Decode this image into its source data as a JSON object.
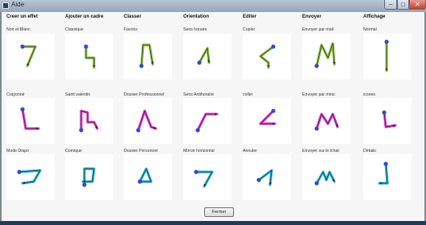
{
  "window": {
    "title": "Aide",
    "controls": {
      "minimize": "–",
      "maximize": "□",
      "close": "✕"
    }
  },
  "colors": {
    "green": "#8ac43f",
    "pink": "#e63bd2",
    "cyan": "#26b9dd",
    "dot": "#2f4cc8",
    "arrow": "#222222"
  },
  "columns": [
    {
      "header": "Creer un effet",
      "items": [
        {
          "label": "Noir et Blanc",
          "gesture": "seven-icon"
        },
        {
          "label": "Crayonné",
          "gesture": "sketch-icon"
        },
        {
          "label": "Mode Diapo",
          "gesture": "slideshow-icon"
        }
      ]
    },
    {
      "header": "Ajouter un cadre",
      "items": [
        {
          "label": "Classique",
          "gesture": "frame-classic-icon"
        },
        {
          "label": "Saint valentin",
          "gesture": "valentine-icon"
        },
        {
          "label": "Comique",
          "gesture": "comic-icon"
        }
      ]
    },
    {
      "header": "Classer",
      "items": [
        {
          "label": "Favoris",
          "gesture": "favorites-icon"
        },
        {
          "label": "Dossier Professionnel",
          "gesture": "pro-folder-icon"
        },
        {
          "label": "Dossier Personnel",
          "gesture": "personal-folder-icon"
        }
      ]
    },
    {
      "header": "Orientation",
      "items": [
        {
          "label": "Sens horaire",
          "gesture": "clockwise-icon"
        },
        {
          "label": "Sens Antihoraire",
          "gesture": "counterclockwise-icon"
        },
        {
          "label": "Mirroir horizontal",
          "gesture": "mirror-icon"
        }
      ]
    },
    {
      "header": "Editer",
      "items": [
        {
          "label": "Copier",
          "gesture": "copy-icon"
        },
        {
          "label": "coller",
          "gesture": "paste-icon"
        },
        {
          "label": "Annuler",
          "gesture": "undo-icon"
        }
      ]
    },
    {
      "header": "Envoyer",
      "items": [
        {
          "label": "Envoyer par mail",
          "gesture": "mail-icon"
        },
        {
          "label": "Envoyer par mms",
          "gesture": "mms-icon"
        },
        {
          "label": "Envoyer sur le tchat",
          "gesture": "chat-icon"
        }
      ]
    },
    {
      "header": "Affichage",
      "items": [
        {
          "label": "Normal",
          "gesture": "normal-icon"
        },
        {
          "label": "icones",
          "gesture": "icons-icon"
        },
        {
          "label": "Détails",
          "gesture": "details-icon"
        }
      ]
    }
  ],
  "footer": {
    "close_label": "Fermer"
  }
}
